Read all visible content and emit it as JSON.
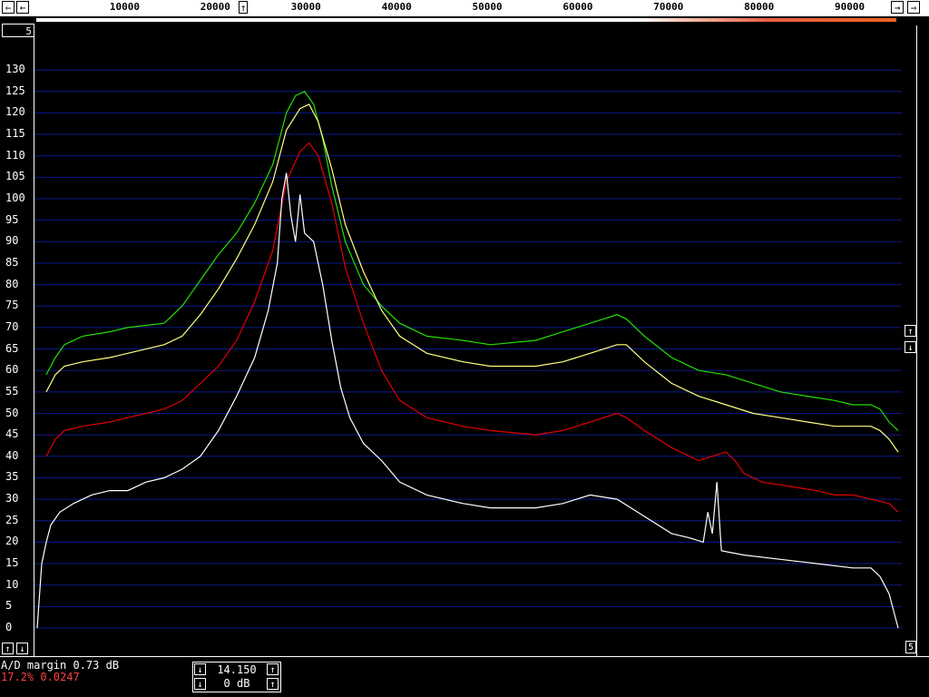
{
  "ruler": {
    "ticks": [
      "10000",
      "20000",
      "30000",
      "40000",
      "50000",
      "60000",
      "70000",
      "80000",
      "90000"
    ],
    "left_buttons": [
      "⇐",
      "←"
    ],
    "right_buttons": [
      "→",
      "⇒"
    ],
    "center_marker": "↑"
  },
  "corner_box": "5",
  "y_axis": {
    "labels": [
      "130",
      "125",
      "120",
      "115",
      "110",
      "105",
      "100",
      "95",
      "90",
      "85",
      "80",
      "75",
      "70",
      "65",
      "60",
      "55",
      "50",
      "45",
      "40",
      "35",
      "30",
      "25",
      "20",
      "15",
      "10",
      "5",
      "0"
    ]
  },
  "side_buttons": {
    "up": "↑",
    "down": "↓"
  },
  "left_bottom_buttons": {
    "up": "↑",
    "down": "↓"
  },
  "waterfall_scale": "5",
  "status": {
    "ad_margin": "A/D margin 0.73 dB",
    "ad_stats": "17.2% 0.0247"
  },
  "control": {
    "value_top": "14.150",
    "value_bottom": "0 dB",
    "down": "↓",
    "up": "↑"
  },
  "colors": {
    "grid": "#0a1a8c",
    "green": "#22e000",
    "yellow": "#ffff80",
    "red": "#e00000",
    "white": "#ffffff"
  },
  "chart_data": {
    "type": "line",
    "xlim": [
      0,
      95000
    ],
    "ylim": [
      0,
      130
    ],
    "series": [
      {
        "color": "#22e000",
        "points": [
          [
            1000,
            59
          ],
          [
            2000,
            63
          ],
          [
            3000,
            66
          ],
          [
            5000,
            68
          ],
          [
            8000,
            69
          ],
          [
            10000,
            70
          ],
          [
            14000,
            71
          ],
          [
            16000,
            75
          ],
          [
            18000,
            81
          ],
          [
            20000,
            87
          ],
          [
            22000,
            92
          ],
          [
            24000,
            99
          ],
          [
            26000,
            108
          ],
          [
            27500,
            120
          ],
          [
            28500,
            124
          ],
          [
            29500,
            125
          ],
          [
            30500,
            122
          ],
          [
            31500,
            114
          ],
          [
            32500,
            103
          ],
          [
            34000,
            90
          ],
          [
            36000,
            80
          ],
          [
            38000,
            75
          ],
          [
            40000,
            71
          ],
          [
            43000,
            68
          ],
          [
            47000,
            67
          ],
          [
            50000,
            66
          ],
          [
            55000,
            67
          ],
          [
            58000,
            69
          ],
          [
            61000,
            71
          ],
          [
            64000,
            73
          ],
          [
            65000,
            72
          ],
          [
            67000,
            68
          ],
          [
            70000,
            63
          ],
          [
            73000,
            60
          ],
          [
            76000,
            59
          ],
          [
            79000,
            57
          ],
          [
            82000,
            55
          ],
          [
            85000,
            54
          ],
          [
            88000,
            53
          ],
          [
            90000,
            52
          ],
          [
            92000,
            52
          ],
          [
            93000,
            51
          ],
          [
            94000,
            48
          ],
          [
            95000,
            46
          ]
        ]
      },
      {
        "color": "#ffff80",
        "points": [
          [
            1000,
            55
          ],
          [
            2000,
            59
          ],
          [
            3000,
            61
          ],
          [
            5000,
            62
          ],
          [
            8000,
            63
          ],
          [
            10000,
            64
          ],
          [
            14000,
            66
          ],
          [
            16000,
            68
          ],
          [
            18000,
            73
          ],
          [
            20000,
            79
          ],
          [
            22000,
            86
          ],
          [
            24000,
            94
          ],
          [
            26000,
            104
          ],
          [
            27500,
            116
          ],
          [
            29000,
            121
          ],
          [
            30000,
            122
          ],
          [
            31000,
            118
          ],
          [
            32500,
            107
          ],
          [
            34000,
            94
          ],
          [
            36000,
            83
          ],
          [
            38000,
            74
          ],
          [
            40000,
            68
          ],
          [
            43000,
            64
          ],
          [
            47000,
            62
          ],
          [
            50000,
            61
          ],
          [
            55000,
            61
          ],
          [
            58000,
            62
          ],
          [
            61000,
            64
          ],
          [
            64000,
            66
          ],
          [
            65000,
            66
          ],
          [
            67000,
            62
          ],
          [
            70000,
            57
          ],
          [
            73000,
            54
          ],
          [
            76000,
            52
          ],
          [
            79000,
            50
          ],
          [
            82000,
            49
          ],
          [
            85000,
            48
          ],
          [
            88000,
            47
          ],
          [
            90000,
            47
          ],
          [
            92000,
            47
          ],
          [
            93000,
            46
          ],
          [
            94000,
            44
          ],
          [
            95000,
            41
          ]
        ]
      },
      {
        "color": "#e00000",
        "points": [
          [
            1000,
            40
          ],
          [
            2000,
            44
          ],
          [
            3000,
            46
          ],
          [
            5000,
            47
          ],
          [
            8000,
            48
          ],
          [
            10000,
            49
          ],
          [
            14000,
            51
          ],
          [
            16000,
            53
          ],
          [
            18000,
            57
          ],
          [
            20000,
            61
          ],
          [
            22000,
            67
          ],
          [
            24000,
            76
          ],
          [
            26000,
            88
          ],
          [
            27500,
            104
          ],
          [
            29000,
            111
          ],
          [
            30000,
            113
          ],
          [
            31000,
            110
          ],
          [
            32500,
            99
          ],
          [
            34000,
            84
          ],
          [
            36000,
            71
          ],
          [
            38000,
            60
          ],
          [
            40000,
            53
          ],
          [
            43000,
            49
          ],
          [
            47000,
            47
          ],
          [
            50000,
            46
          ],
          [
            55000,
            45
          ],
          [
            58000,
            46
          ],
          [
            61000,
            48
          ],
          [
            64000,
            50
          ],
          [
            65000,
            49
          ],
          [
            67000,
            46
          ],
          [
            70000,
            42
          ],
          [
            73000,
            39
          ],
          [
            76000,
            41
          ],
          [
            77000,
            39
          ],
          [
            78000,
            36
          ],
          [
            80000,
            34
          ],
          [
            83000,
            33
          ],
          [
            86000,
            32
          ],
          [
            88000,
            31
          ],
          [
            90000,
            31
          ],
          [
            92000,
            30
          ],
          [
            94000,
            29
          ],
          [
            95000,
            27
          ]
        ]
      },
      {
        "color": "#ffffff",
        "points": [
          [
            0,
            0
          ],
          [
            500,
            15
          ],
          [
            1000,
            20
          ],
          [
            1500,
            24
          ],
          [
            2500,
            27
          ],
          [
            4000,
            29
          ],
          [
            6000,
            31
          ],
          [
            8000,
            32
          ],
          [
            10000,
            32
          ],
          [
            12000,
            34
          ],
          [
            14000,
            35
          ],
          [
            16000,
            37
          ],
          [
            18000,
            40
          ],
          [
            20000,
            46
          ],
          [
            22000,
            54
          ],
          [
            24000,
            63
          ],
          [
            25500,
            74
          ],
          [
            26500,
            85
          ],
          [
            27000,
            100
          ],
          [
            27500,
            106
          ],
          [
            28000,
            96
          ],
          [
            28500,
            90
          ],
          [
            29000,
            101
          ],
          [
            29500,
            92
          ],
          [
            30500,
            90
          ],
          [
            31500,
            80
          ],
          [
            32500,
            67
          ],
          [
            33500,
            56
          ],
          [
            34500,
            49
          ],
          [
            36000,
            43
          ],
          [
            38000,
            39
          ],
          [
            40000,
            34
          ],
          [
            43000,
            31
          ],
          [
            47000,
            29
          ],
          [
            50000,
            28
          ],
          [
            55000,
            28
          ],
          [
            58000,
            29
          ],
          [
            61000,
            31
          ],
          [
            64000,
            30
          ],
          [
            67000,
            26
          ],
          [
            70000,
            22
          ],
          [
            72000,
            21
          ],
          [
            73500,
            20
          ],
          [
            74000,
            27
          ],
          [
            74500,
            22
          ],
          [
            75000,
            34
          ],
          [
            75500,
            18
          ],
          [
            78000,
            17
          ],
          [
            82000,
            16
          ],
          [
            86000,
            15
          ],
          [
            90000,
            14
          ],
          [
            92000,
            14
          ],
          [
            93000,
            12
          ],
          [
            94000,
            8
          ],
          [
            95000,
            0
          ]
        ]
      }
    ]
  }
}
